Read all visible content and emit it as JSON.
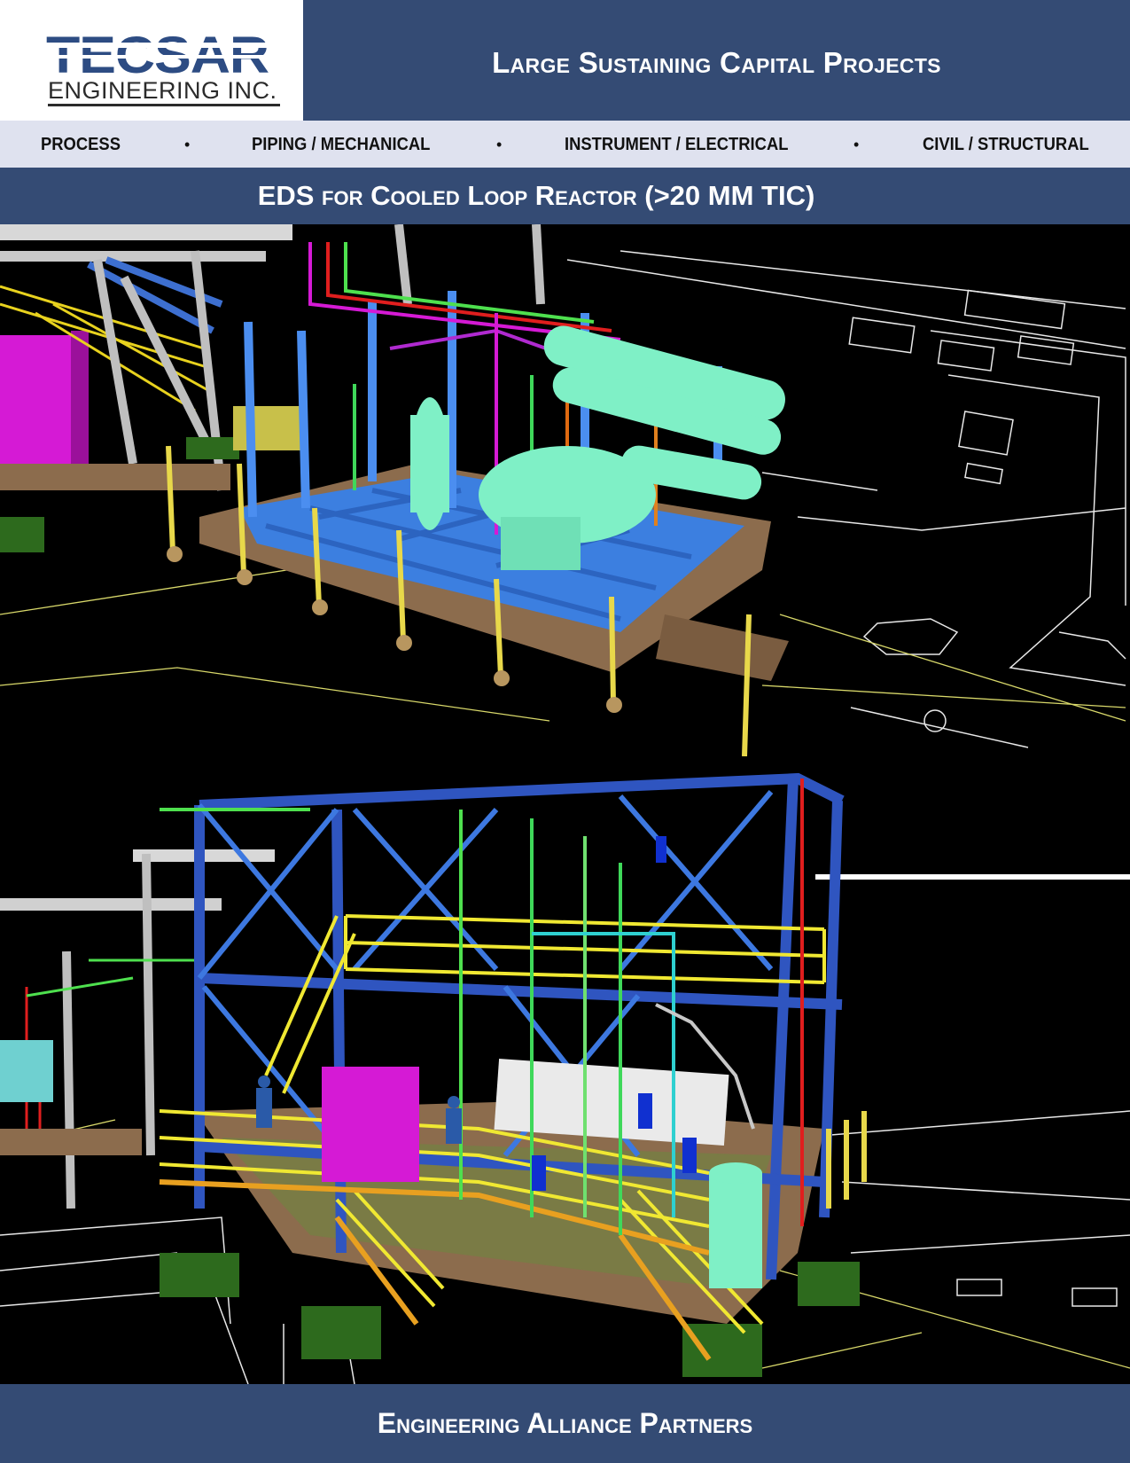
{
  "header": {
    "logo_main": "TECSAR",
    "logo_sub": "ENGINEERING INC.",
    "title": "Large Sustaining Capital Projects"
  },
  "disciplines": {
    "items": [
      "PROCESS",
      "PIPING / MECHANICAL",
      "INSTRUMENT / ELECTRICAL",
      "CIVIL / STRUCTURAL"
    ],
    "separator": "•"
  },
  "subtitle": "EDS for Cooled Loop Reactor (>20 MM TIC)",
  "images": {
    "top": "3D model render of cooled loop reactor skid with vessels, piping and structural frame",
    "bottom": "3D model render of multi-level steel structure with platforms, stairs, equipment and piping"
  },
  "footer": {
    "title": "Engineering Alliance Partners"
  },
  "colors": {
    "brand_navy": "#344b74",
    "logo_blue": "#2d4c83",
    "bar_light": "#dfe2ef"
  }
}
